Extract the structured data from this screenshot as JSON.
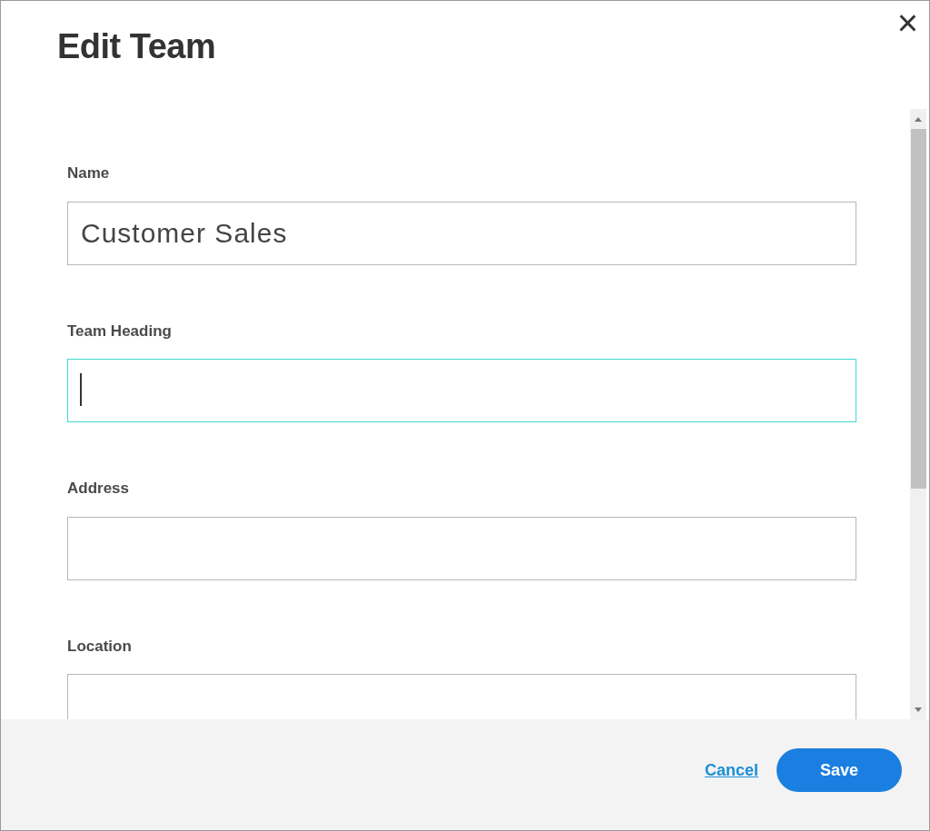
{
  "dialog": {
    "title": "Edit Team",
    "close": "×"
  },
  "fields": [
    {
      "label": "Name",
      "value": "Customer Sales",
      "focused": false
    },
    {
      "label": "Team Heading",
      "focused": true
    },
    {
      "label": "Address",
      "focused": false
    },
    {
      "label": "Location",
      "focused": false
    }
  ],
  "footer": {
    "cancel": "Cancel",
    "save": "Save"
  }
}
